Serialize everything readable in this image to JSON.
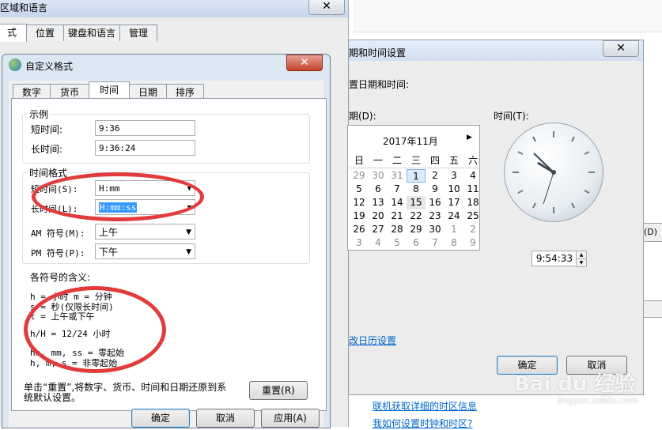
{
  "region_window": {
    "title": "区域和语言",
    "close_icon": "close-icon",
    "tabs": [
      "式",
      "位置",
      "键盘和语言",
      "管理"
    ]
  },
  "datetime_window": {
    "title": "期和时间设置",
    "subtitle": "置日期和时间:",
    "date_label": "期(D):",
    "time_label": "时间(T):",
    "calendar": {
      "month": "2017年11月",
      "headers": [
        "日",
        "一",
        "二",
        "三",
        "四",
        "五",
        "六"
      ],
      "rows": [
        [
          "29",
          "30",
          "31",
          "1",
          "2",
          "3",
          "4"
        ],
        [
          "5",
          "6",
          "7",
          "8",
          "9",
          "10",
          "11"
        ],
        [
          "12",
          "13",
          "14",
          "15",
          "16",
          "17",
          "18"
        ],
        [
          "19",
          "20",
          "21",
          "22",
          "23",
          "24",
          "25"
        ],
        [
          "26",
          "27",
          "28",
          "29",
          "30",
          "1",
          "2"
        ],
        [
          "3",
          "4",
          "5",
          "6",
          "7",
          "8",
          "9"
        ]
      ],
      "selected": "1",
      "today": "15"
    },
    "clock_time": "9:54:33",
    "calendar_link": "改日历设置",
    "ok": "确定",
    "cancel": "取消",
    "right_cut_label": "(D)"
  },
  "bottom_links": {
    "link1": "联机获取详细的时区信息",
    "link2": "我如何设置时钟和时区?"
  },
  "custom_format": {
    "title": "自定义格式",
    "tabs": [
      "数字",
      "货币",
      "时间",
      "日期",
      "排序"
    ],
    "active_tab": "时间",
    "example": {
      "legend": "示例",
      "short_label": "短时间:",
      "short_value": "9:36",
      "long_label": "长时间:",
      "long_value": "9:36:24"
    },
    "time_format": {
      "legend": "时间格式",
      "short_label": "短时间(S):",
      "short_value": "H:mm",
      "long_label": "长时间(L):",
      "long_value": "H:mm:ss",
      "am_label": "AM 符号(M):",
      "am_value": "上午",
      "pm_label": "PM 符号(P):",
      "pm_value": "下午"
    },
    "meaning": {
      "title": "各符号的含义:",
      "line1": "h = 小时   m = 分钟",
      "line2": "s = 秒(仅限长时间)",
      "line3": "t = 上午或下午",
      "line4": "h/H = 12/24 小时",
      "line5": "hh, mm, ss = 零起始",
      "line6": "h, m, s = 非零起始"
    },
    "reset_text_1": "单击“重置”,将数字、货币、时间和日期还原到系",
    "reset_text_2": "统默认设置。",
    "reset_button": "重置(R)",
    "ok": "确定",
    "cancel": "取消",
    "apply": "应用(A)"
  },
  "watermark": {
    "brand": "Bai du 经验",
    "url": "jingyan.baidu.com"
  },
  "annotation_color": "#e23b3b"
}
